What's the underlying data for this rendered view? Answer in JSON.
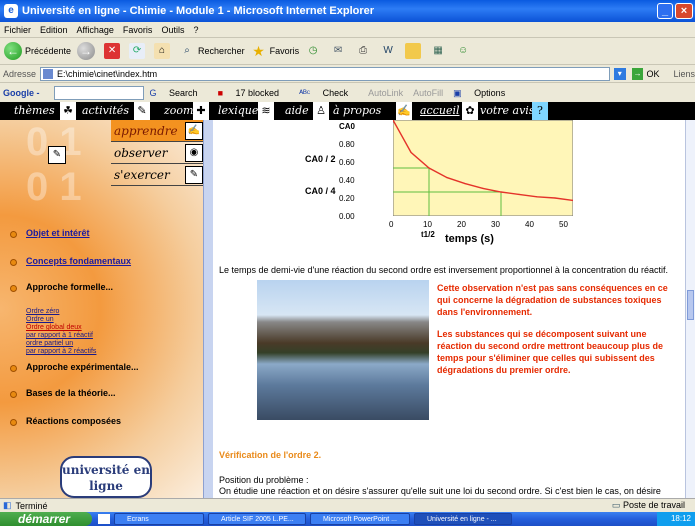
{
  "window": {
    "title": "Université en ligne - Chimie - Module 1 - Microsoft Internet Explorer",
    "controls": [
      "minimize",
      "maximize",
      "close"
    ]
  },
  "menu": [
    "Fichier",
    "Edition",
    "Affichage",
    "Favoris",
    "Outils",
    "?"
  ],
  "toolbar": {
    "back_label": "Précédente",
    "search_label": "Rechercher",
    "favorites_label": "Favoris"
  },
  "address": {
    "label": "Adresse",
    "value": "E:\\chimie\\cinet\\index.htm",
    "go_label": "OK",
    "links_label": "Liens"
  },
  "google": {
    "label": "Google -",
    "search_label": "Search",
    "blocked_label": "17 blocked",
    "check_label": "Check",
    "autolink_label": "AutoLink",
    "autofill_label": "AutoFill",
    "options_label": "Options"
  },
  "site_nav": [
    "thèmes",
    "activités",
    "zoom",
    "lexique",
    "aide",
    "à propos",
    "accueil",
    "votre avis"
  ],
  "submenu": [
    "apprendre",
    "observer",
    "s'exercer"
  ],
  "sidebar": {
    "links": [
      "Objet et intérêt",
      "Concepts fondamentaux",
      "Approche formelle...",
      "Approche expérimentale...",
      "Bases de la théorie...",
      "Réactions composées"
    ],
    "sub_links": [
      "Ordre zéro",
      "Ordre un",
      "Ordre global deux",
      "par rapport à 1 réactif",
      "ordre partiel un",
      "par rapport à 2 réactifs"
    ],
    "logo_text": "université en ligne"
  },
  "chart_data": {
    "type": "line",
    "ylabel_ticks": [
      "0.80",
      "0.60",
      "0.40",
      "0.20",
      "0.00"
    ],
    "xlabel": "temps (s)",
    "x_ticks": [
      "0",
      "10",
      "20",
      "30",
      "40",
      "50"
    ],
    "x_marker": "t1/2",
    "y_labels": [
      "CA0",
      "CA0 / 2",
      "CA0 / 4"
    ],
    "series": [
      {
        "x": [
          0,
          5,
          10,
          15,
          20,
          25,
          30,
          35,
          40,
          45,
          50
        ],
        "values": [
          0.8,
          0.53,
          0.4,
          0.32,
          0.27,
          0.23,
          0.2,
          0.18,
          0.16,
          0.15,
          0.13
        ]
      }
    ],
    "ylim": [
      0,
      0.8
    ],
    "xlim": [
      0,
      50
    ]
  },
  "content": {
    "intro": "Le temps de demi-vie d'une réaction du second ordre est inversement proportionnel à la concentration du réactif.",
    "callout1": "Cette observation n'est pas sans conséquences en ce qui concerne la dégradation de substances toxiques dans l'environnement.",
    "callout2": "Les substances qui se décomposent suivant une réaction du second ordre mettront beaucoup plus de temps pour s'éliminer que celles qui subissent des dégradations du premier ordre.",
    "section_title": "Vérification de l'ordre 2.",
    "problem_title": "Position du problème :",
    "problem_text": "On étudie une réaction et on désire s'assurer qu'elle suit une loi du second ordre. Si c'est bien le cas, on désire"
  },
  "status": {
    "left": "Terminé",
    "right": "Poste de travail"
  },
  "taskbar": {
    "start": "démarrer",
    "tasks": [
      "Ecrans",
      "Article SIF 2005 L.PE...",
      "Microsoft PowerPoint ...",
      "Université en ligne - ..."
    ],
    "clock": "18:12"
  }
}
